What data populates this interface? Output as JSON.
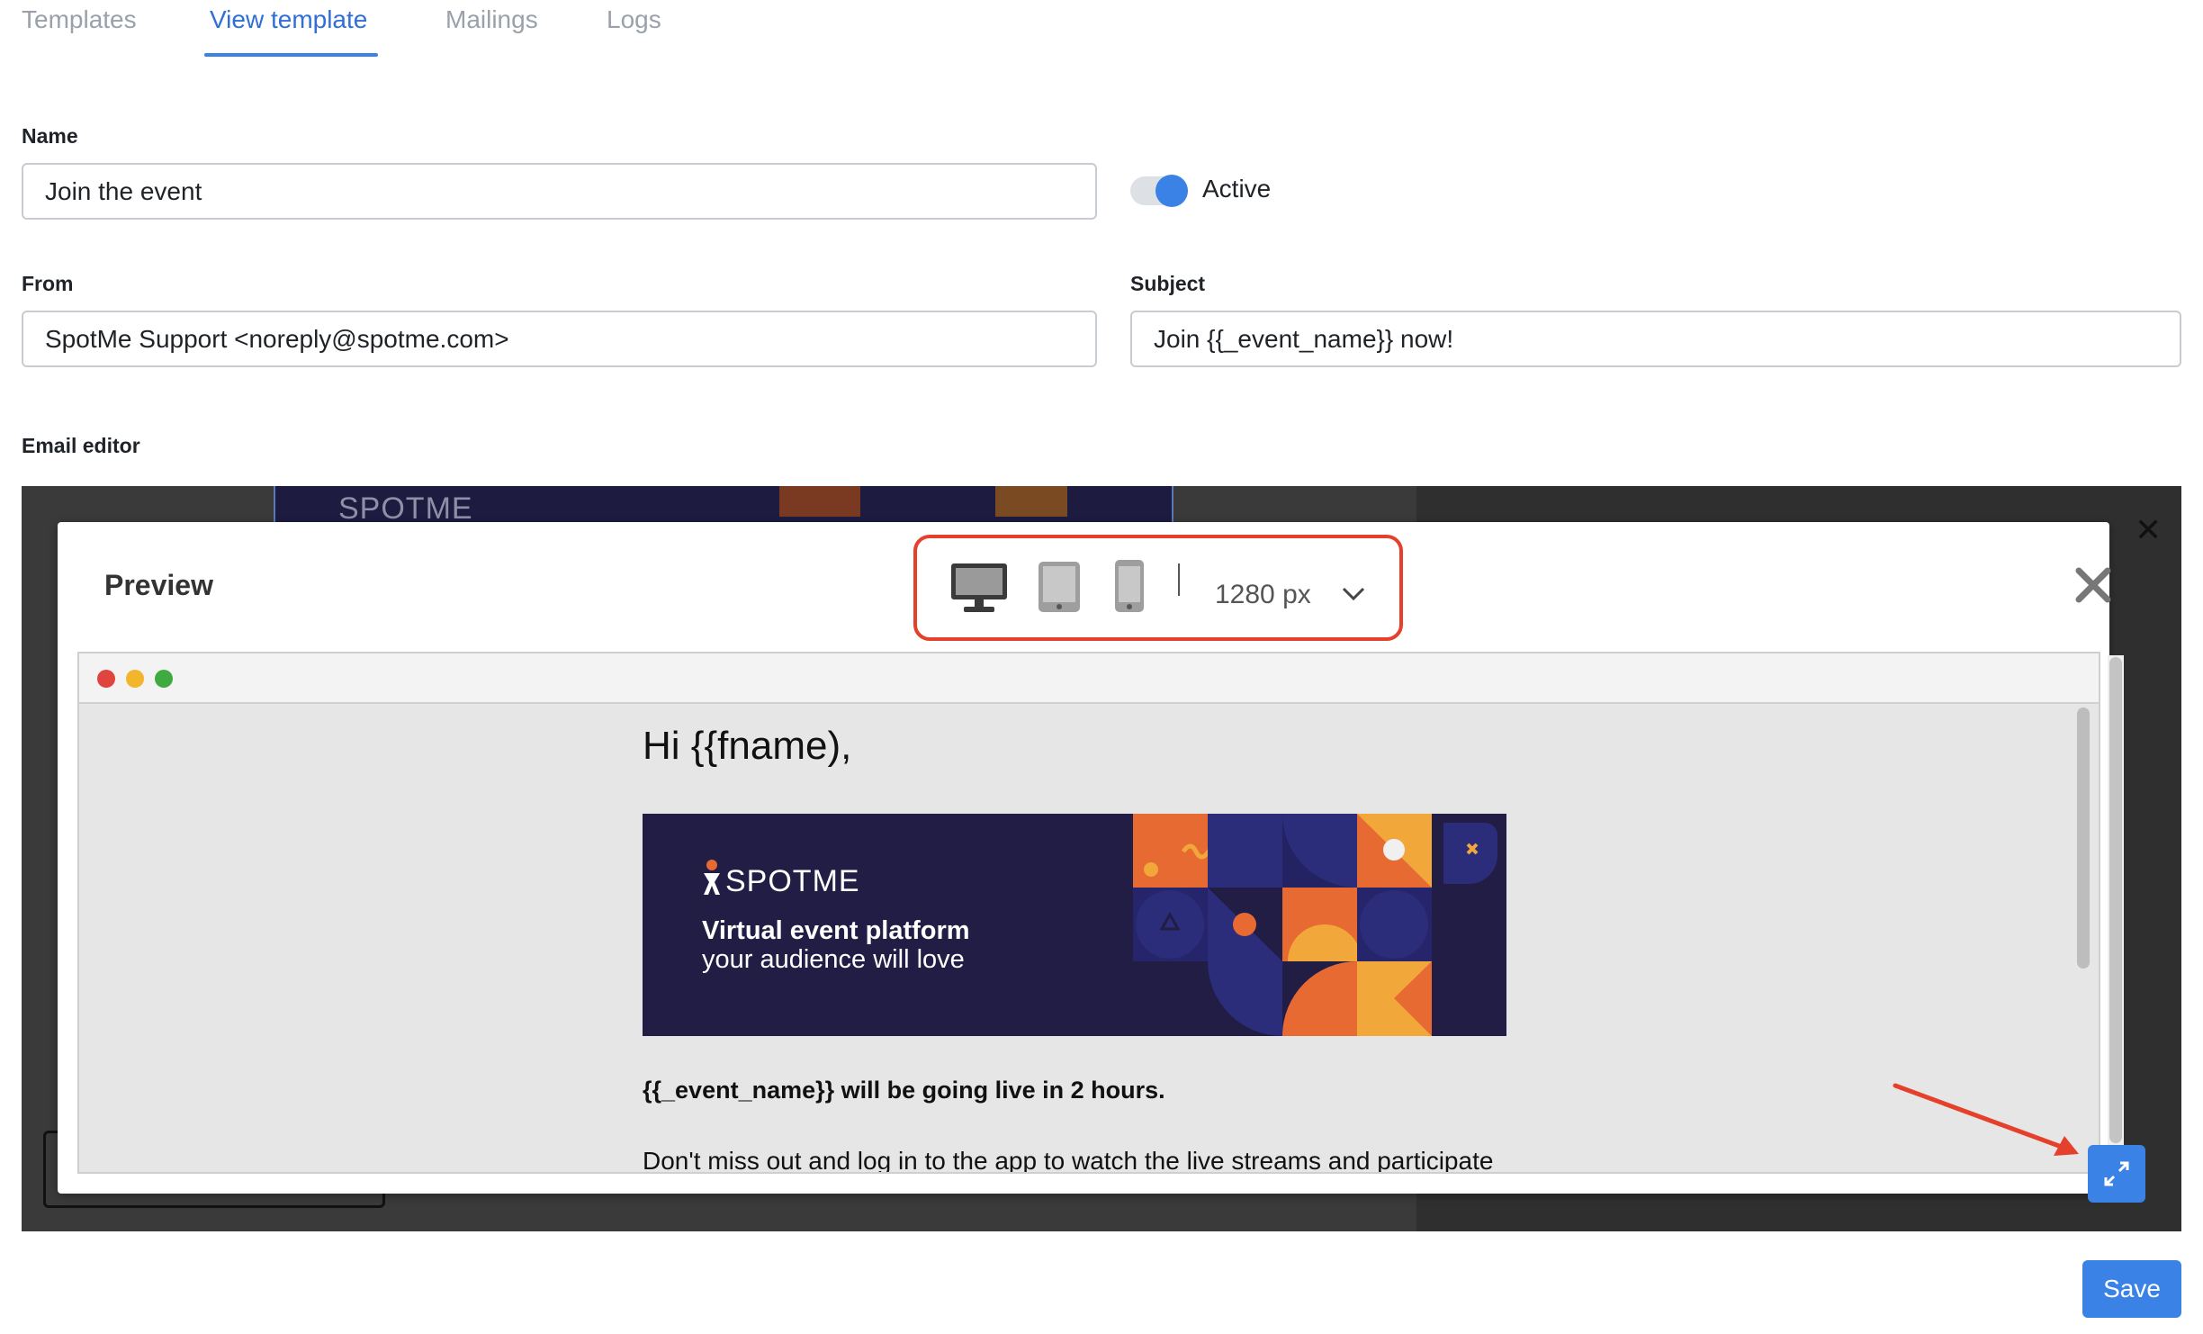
{
  "tabs": [
    {
      "label": "Templates",
      "active": false
    },
    {
      "label": "View template",
      "active": true
    },
    {
      "label": "Mailings",
      "active": false
    },
    {
      "label": "Logs",
      "active": false
    }
  ],
  "form": {
    "name_label": "Name",
    "name_value": "Join the event",
    "active_label": "Active",
    "active_on": true,
    "from_label": "From",
    "from_value": "SpotMe Support <noreply@spotme.com>",
    "subject_label": "Subject",
    "subject_value": "Join {{_event_name}} now!",
    "email_editor_label": "Email editor"
  },
  "editor_background": {
    "banner_logo": "SPOTME"
  },
  "preview": {
    "title": "Preview",
    "devices": [
      "desktop-icon",
      "tablet-icon",
      "mobile-icon"
    ],
    "selected_device": "desktop",
    "width": "1280 px"
  },
  "email": {
    "greeting": "Hi {{fname),",
    "banner_logo": "SPOTME",
    "banner_line1": "Virtual event platform",
    "banner_line2": "your audience will love",
    "bold_line": "{{_event_name}} will be going live in 2 hours.",
    "body_line": "Don't miss out and log in to the app to watch the live streams and participate"
  },
  "actions": {
    "save_label": "Save"
  },
  "colors": {
    "accent": "#3b82e6",
    "highlight": "#e5402b",
    "banner_bg": "#221d45",
    "banner_orange": "#e86a33",
    "banner_yellow": "#f2a73b"
  }
}
